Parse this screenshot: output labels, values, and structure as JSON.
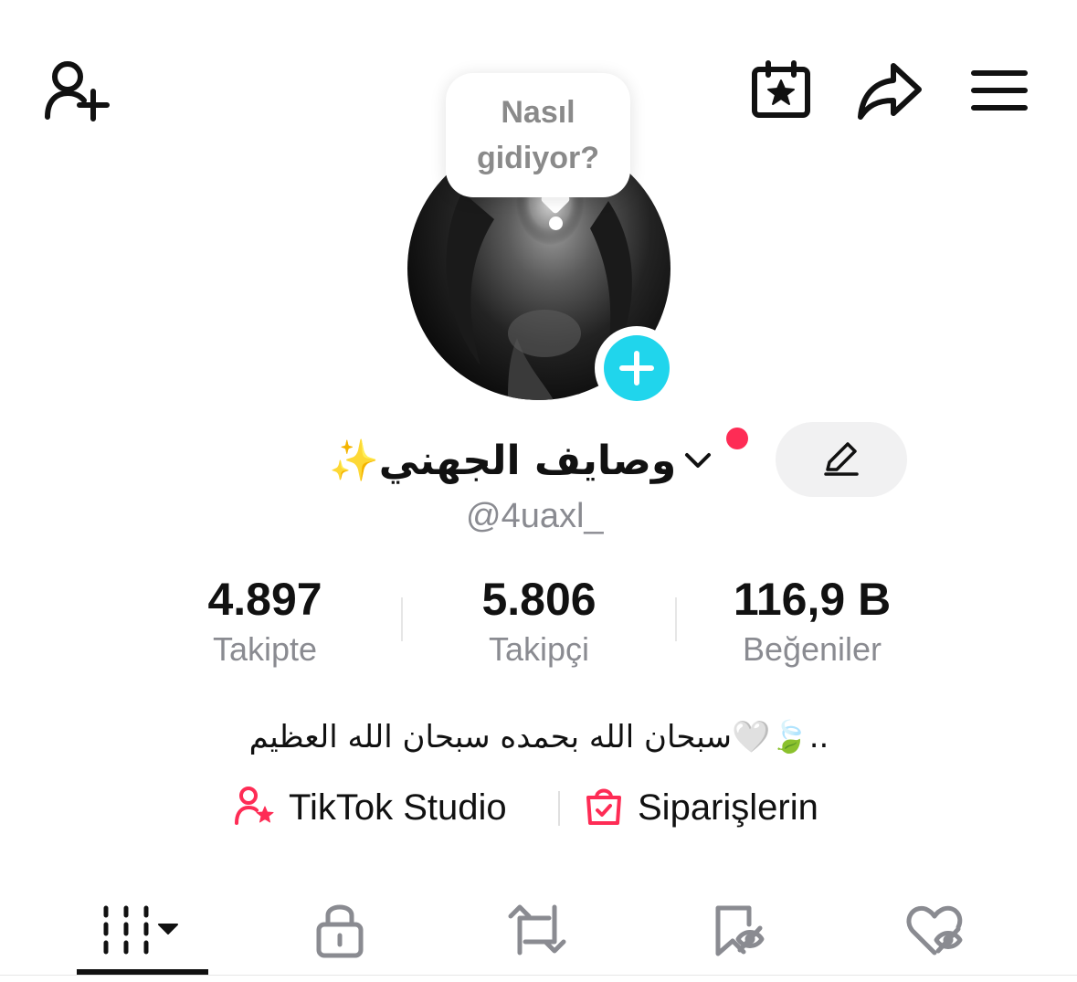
{
  "header": {
    "icons": [
      "add-user-icon",
      "calendar-star-icon",
      "share-icon",
      "menu-icon"
    ]
  },
  "bubble": {
    "text": "Nasıl gidiyor?"
  },
  "profile": {
    "display_name": "وصايف الجهني✨",
    "username": "@4uaxl_",
    "bio": "سبحان الله بحمده سبحان الله العظيم🤍🍃.."
  },
  "stats": [
    {
      "value": "4.897",
      "label": "Takipte"
    },
    {
      "value": "5.806",
      "label": "Takipçi"
    },
    {
      "value": "116,9 B",
      "label": "Beğeniler"
    }
  ],
  "links": {
    "studio": "TikTok Studio",
    "orders": "Siparişlerin"
  },
  "tabs": [
    {
      "icon": "grid-videos-icon"
    },
    {
      "icon": "lock-icon"
    },
    {
      "icon": "repost-icon"
    },
    {
      "icon": "favorites-hidden-icon"
    },
    {
      "icon": "liked-hidden-icon"
    }
  ],
  "colors": {
    "accent_red": "#fe2c55",
    "accent_cyan": "#20d5ec",
    "muted": "#8a8b91"
  }
}
